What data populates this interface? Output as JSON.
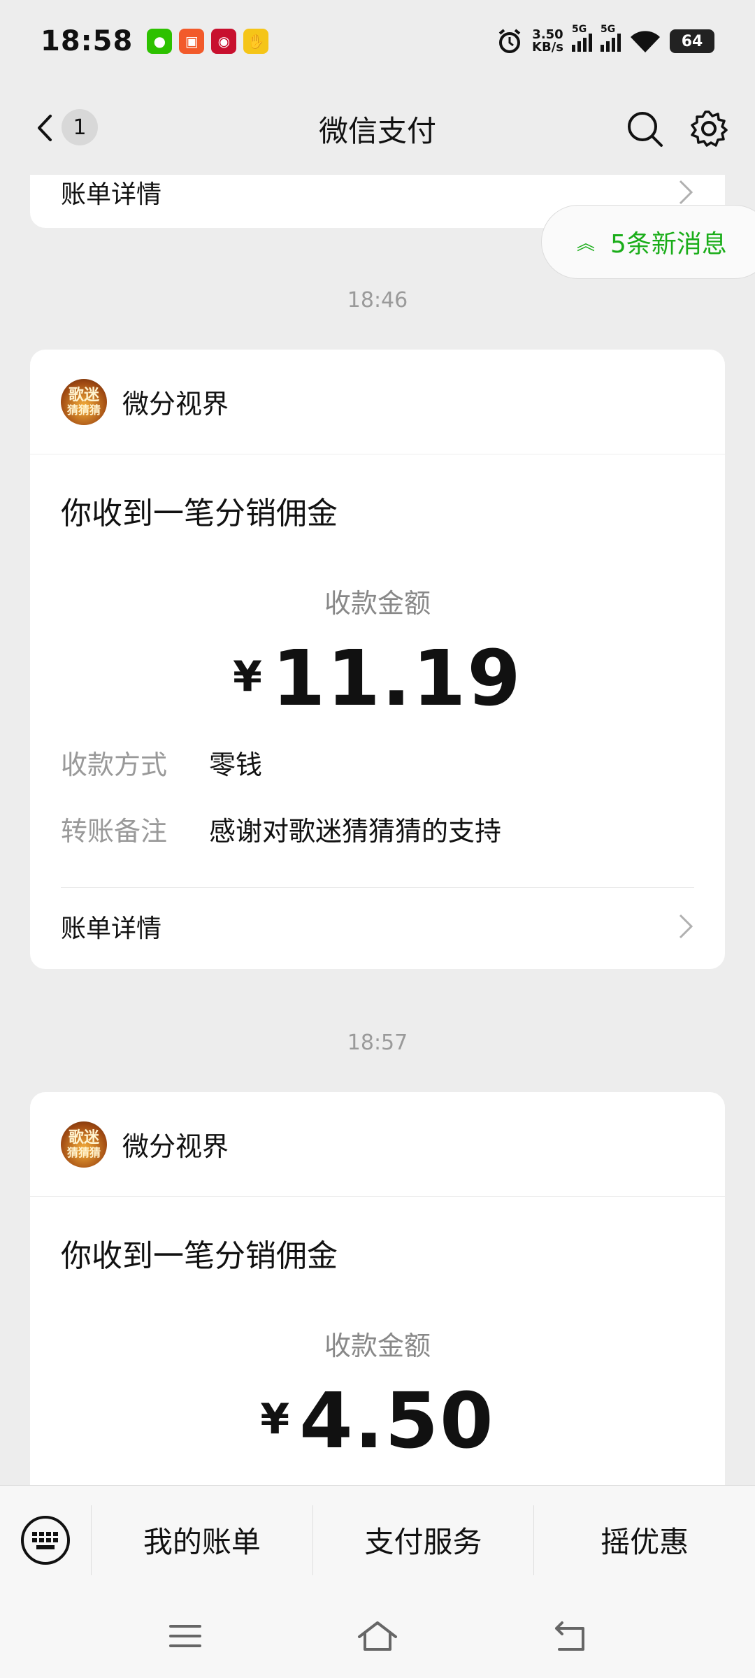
{
  "status_bar": {
    "time": "18:58",
    "net_speed_value": "3.50",
    "net_speed_unit": "KB/s",
    "signal1_label": "5G",
    "signal2_label": "5G",
    "battery": "64",
    "app_icons": [
      "wechat-icon",
      "app-icon-2",
      "app-icon-3",
      "app-icon-4"
    ]
  },
  "nav": {
    "back_badge": "1",
    "title": "微信支付"
  },
  "top_card": {
    "detail_label": "账单详情"
  },
  "new_messages": {
    "label": "5条新消息"
  },
  "messages": [
    {
      "time": "18:46",
      "sender": "微分视界",
      "avatar_text_top": "歌迷",
      "avatar_text_bottom": "猜猜猜",
      "title": "你收到一笔分销佣金",
      "amount_label": "收款金额",
      "currency": "¥",
      "amount": "11.19",
      "method_key": "收款方式",
      "method_value": "零钱",
      "note_key": "转账备注",
      "note_value": "感谢对歌迷猜猜猜的支持",
      "detail_label": "账单详情"
    },
    {
      "time": "18:57",
      "sender": "微分视界",
      "avatar_text_top": "歌迷",
      "avatar_text_bottom": "猜猜猜",
      "title": "你收到一笔分销佣金",
      "amount_label": "收款金额",
      "currency": "¥",
      "amount": "4.50"
    }
  ],
  "bottom_menu": {
    "items": [
      "我的账单",
      "支付服务",
      "摇优惠"
    ]
  },
  "colors": {
    "accent": "#1aad19",
    "background": "#ededed",
    "card": "#ffffff"
  }
}
